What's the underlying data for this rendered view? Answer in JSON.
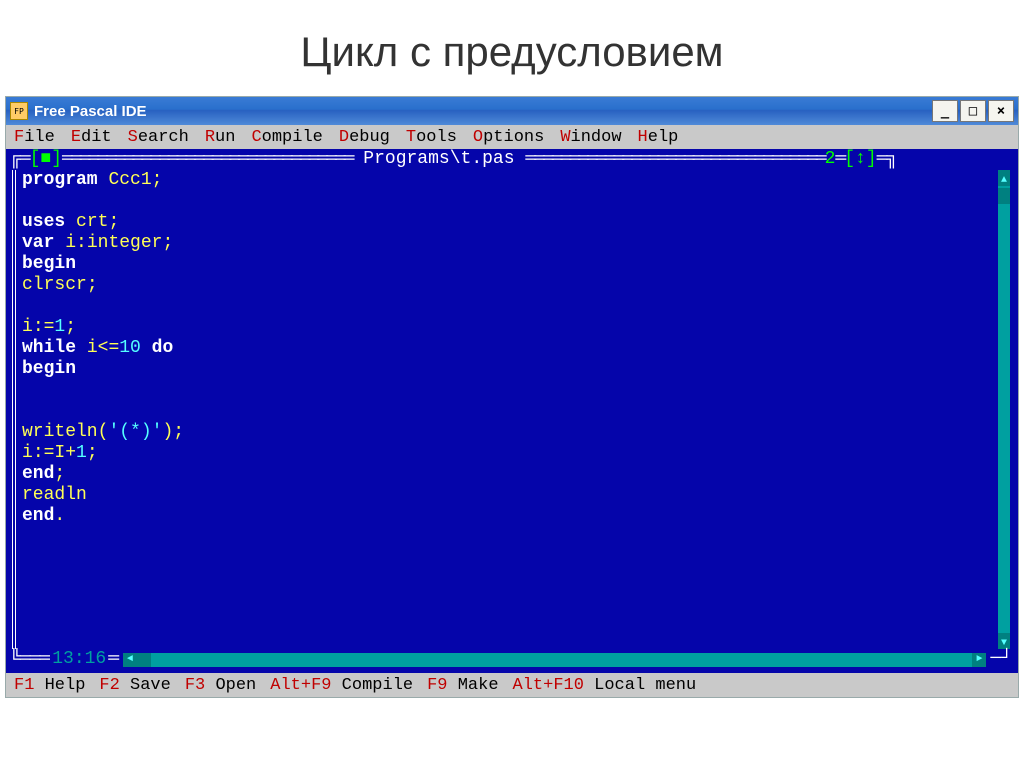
{
  "slide": {
    "title": "Цикл с предусловием"
  },
  "window": {
    "title": "Free Pascal IDE",
    "controls": {
      "minimize": "_",
      "maximize": "□",
      "close": "×"
    }
  },
  "menubar": [
    {
      "hotkey": "F",
      "rest": "ile"
    },
    {
      "hotkey": "E",
      "rest": "dit"
    },
    {
      "hotkey": "S",
      "rest": "earch"
    },
    {
      "hotkey": "R",
      "rest": "un"
    },
    {
      "hotkey": "C",
      "rest": "ompile"
    },
    {
      "hotkey": "D",
      "rest": "ebug"
    },
    {
      "hotkey": "T",
      "rest": "ools"
    },
    {
      "hotkey": "O",
      "rest": "ptions"
    },
    {
      "hotkey": "W",
      "rest": "indow"
    },
    {
      "hotkey": "H",
      "rest": "elp"
    }
  ],
  "editor": {
    "tab_close": "[■]",
    "filename": "Programs\\t.pas",
    "window_number": "2",
    "zoom_marker": "[↕]",
    "cursor_pos": "13:16",
    "code": [
      [
        {
          "c": "kw",
          "t": "program"
        },
        {
          "c": "plain",
          "t": " "
        },
        {
          "c": "ident",
          "t": "Ccc1"
        },
        {
          "c": "sym",
          "t": ";"
        }
      ],
      [],
      [
        {
          "c": "kw",
          "t": "uses"
        },
        {
          "c": "plain",
          "t": " "
        },
        {
          "c": "ident",
          "t": "crt"
        },
        {
          "c": "sym",
          "t": ";"
        }
      ],
      [
        {
          "c": "kw",
          "t": "var"
        },
        {
          "c": "plain",
          "t": " "
        },
        {
          "c": "ident",
          "t": "i"
        },
        {
          "c": "sym",
          "t": ":"
        },
        {
          "c": "ident",
          "t": "integer"
        },
        {
          "c": "sym",
          "t": ";"
        }
      ],
      [
        {
          "c": "kw",
          "t": "begin"
        }
      ],
      [
        {
          "c": "ident",
          "t": "clrscr"
        },
        {
          "c": "sym",
          "t": ";"
        }
      ],
      [],
      [
        {
          "c": "ident",
          "t": "i"
        },
        {
          "c": "sym",
          "t": ":="
        },
        {
          "c": "num",
          "t": "1"
        },
        {
          "c": "sym",
          "t": ";"
        }
      ],
      [
        {
          "c": "kw",
          "t": "while"
        },
        {
          "c": "plain",
          "t": " "
        },
        {
          "c": "ident",
          "t": "i"
        },
        {
          "c": "sym",
          "t": "<="
        },
        {
          "c": "num",
          "t": "10"
        },
        {
          "c": "plain",
          "t": " "
        },
        {
          "c": "kw",
          "t": "do"
        }
      ],
      [
        {
          "c": "kw",
          "t": "begin"
        }
      ],
      [],
      [],
      [
        {
          "c": "ident",
          "t": "writeln"
        },
        {
          "c": "sym",
          "t": "("
        },
        {
          "c": "str",
          "t": "'(*)'"
        },
        {
          "c": "sym",
          "t": ")"
        },
        {
          "c": "sym",
          "t": ";"
        }
      ],
      [
        {
          "c": "ident",
          "t": "i"
        },
        {
          "c": "sym",
          "t": ":="
        },
        {
          "c": "ident",
          "t": "I"
        },
        {
          "c": "sym",
          "t": "+"
        },
        {
          "c": "num",
          "t": "1"
        },
        {
          "c": "sym",
          "t": ";"
        }
      ],
      [
        {
          "c": "kw",
          "t": "end"
        },
        {
          "c": "sym",
          "t": ";"
        }
      ],
      [
        {
          "c": "ident",
          "t": "readln"
        }
      ],
      [
        {
          "c": "kw",
          "t": "end"
        },
        {
          "c": "sym",
          "t": "."
        }
      ]
    ]
  },
  "statusbar": [
    {
      "fkey": "F1",
      "label": " Help"
    },
    {
      "fkey": "F2",
      "label": " Save"
    },
    {
      "fkey": "F3",
      "label": " Open"
    },
    {
      "fkey": "Alt+F9",
      "label": " Compile"
    },
    {
      "fkey": "F9",
      "label": " Make"
    },
    {
      "fkey": "Alt+F10",
      "label": " Local menu"
    }
  ]
}
